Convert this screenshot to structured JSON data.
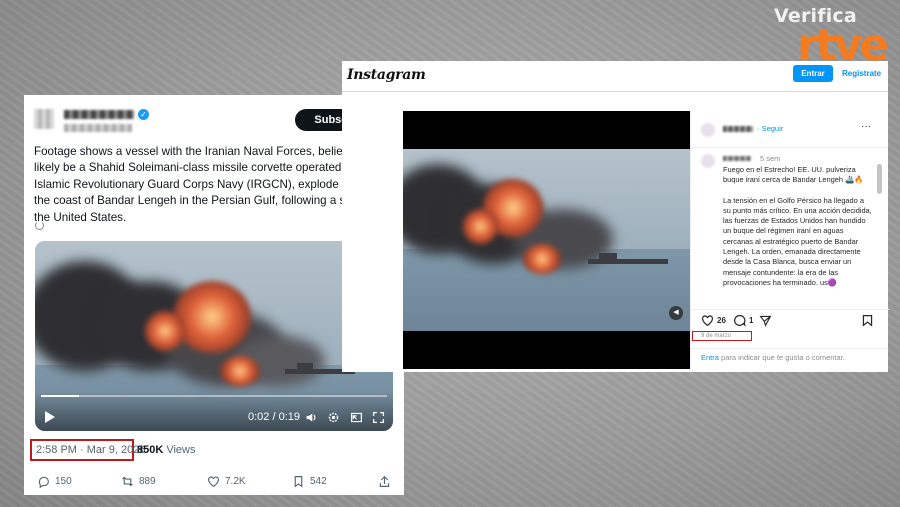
{
  "brand": {
    "verifica": "Verifica",
    "rtve": "rtve"
  },
  "x_post": {
    "subscribe_label": "Subscribe",
    "more_glyph": "···",
    "text": "Footage shows a vessel with the Iranian Naval Forces, believed to likely be a Shahid Soleimani-class missile corvette operated by the Islamic Revolutionary Guard Corps Navy (IRGCN), explode today off the coast of Bandar Lengeh in the Persian Gulf, following a strike by the United States.",
    "video_time": "0:02 / 0:19",
    "progress": 0.11,
    "timestamp": "2:58 PM · Mar 9, 2026",
    "views_count": "850K",
    "views_label": " Views",
    "replies": "150",
    "reposts": "889",
    "likes": "7.2K",
    "bookmarks": "542",
    "highlight_color": "#c0191f"
  },
  "instagram": {
    "logo": "Instagram",
    "enter_label": "Entrar",
    "register_label": "Registrate",
    "follow_label": "· Seguir",
    "more_glyph": "···",
    "post_age": "5 sem",
    "caption_title": "Fuego en el Estrecho! EE. UU. pulveriza buque iraní cerca de Bandar Lengeh 🚢🔥",
    "caption_body": "La tensión en el Golfo Pérsico ha llegado a su punto más crítico. En una acción decidida, las fuerzas de Estados Unidos han hundido un buque del régimen iraní en aguas cercanas al estratégico puerto de Bandar Lengeh. La orden, emanada directamente desde la Casa Blanca, busca enviar un mensaje contundente: la era de las provocaciones ha terminado. us🟣",
    "likes": "26",
    "comments": "1",
    "date": "9 de marzo",
    "login_link": "Entra",
    "login_text": " para indicar que te gusta o comentar.",
    "accent": "#0095f6"
  }
}
